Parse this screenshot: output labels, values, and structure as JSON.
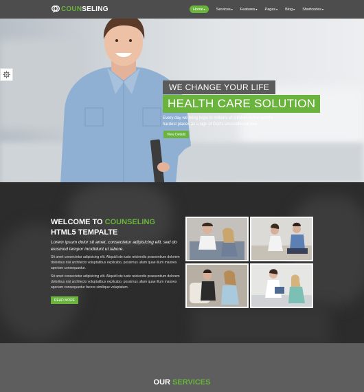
{
  "brand": {
    "logo_accent": "COUN",
    "logo_rest": "SELING",
    "accent_color": "#6ab43e"
  },
  "nav": {
    "items": [
      {
        "label": "Home",
        "active": true
      },
      {
        "label": "Services",
        "active": false
      },
      {
        "label": "Features",
        "active": false
      },
      {
        "label": "Pages",
        "active": false
      },
      {
        "label": "Blog",
        "active": false
      },
      {
        "label": "Shortcodes",
        "active": false
      }
    ]
  },
  "hero": {
    "tagline": "WE CHANGE YOUR LIFE",
    "title": "HEALTH CARE SOLUTION",
    "text": "Every day we bring hope to millions of children in the world's hardest places as a sign of God's unconditional love.",
    "button": "View Details"
  },
  "about": {
    "heading_prefix": "WELCOME TO ",
    "heading_accent": "COUNSELING",
    "heading_line2": "HTML5 TEMPALTE",
    "lead": "Lorem ipsum dolor sit amet, consectetur adipisicing elit, sed do eiusmod tempor incididunt ut labore.",
    "para1": "Sit amet consectetur adipisicing elit. Aliquid iste iusto reiciendis praesentium dolorem doloribus nisi architecto voluptatibus explicabo, possimus ullam quae illum maiores aperiam consequuntur.",
    "para2": "Sit amet consectetur adipisicing elit. Aliquid iste iusto reiciendis praesentium dolorem doloribus nisi architecto voluptatibus explicabo, possimus ullam quae illum maiores aperiam consequuntur facere similique voluptatum.",
    "button": "READ MORE"
  },
  "services": {
    "title_prefix": "OUR ",
    "title_accent": "SERVICES"
  }
}
